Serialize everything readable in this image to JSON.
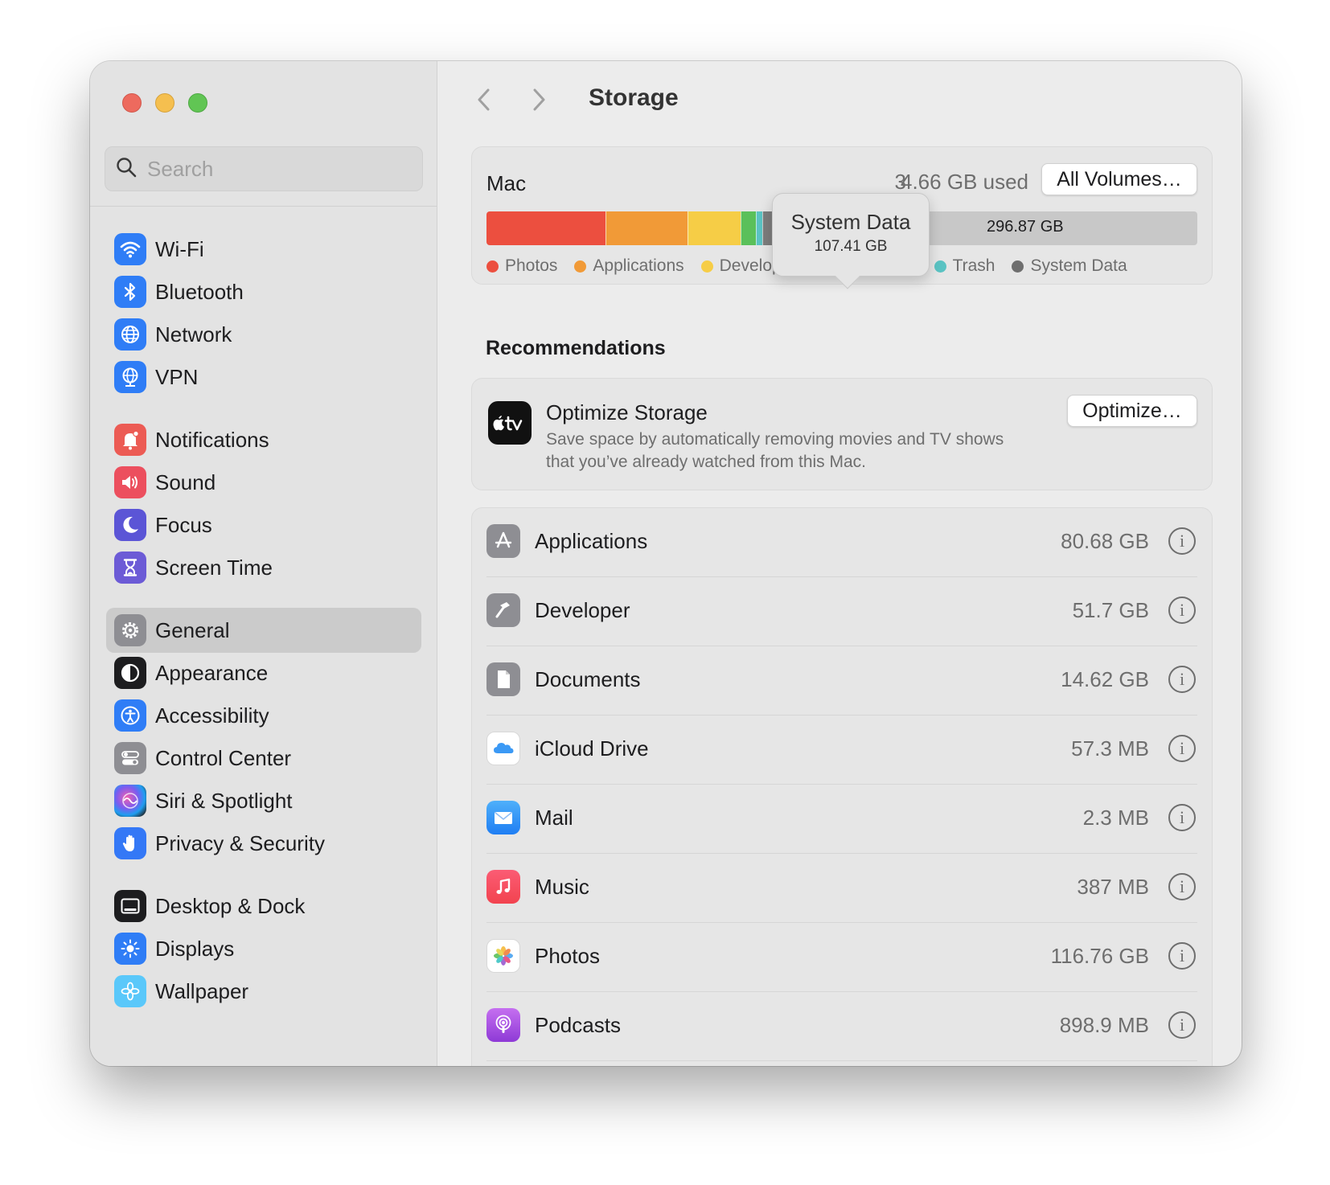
{
  "window": {
    "controls": [
      "close",
      "minimize",
      "zoom"
    ]
  },
  "sidebar": {
    "search": {
      "placeholder": "Search",
      "value": ""
    },
    "items": [
      {
        "label": "Wi-Fi",
        "icon": "wifi-icon",
        "color": "#2f7df6"
      },
      {
        "label": "Bluetooth",
        "icon": "bluetooth-icon",
        "color": "#2f7df6"
      },
      {
        "label": "Network",
        "icon": "globe-icon",
        "color": "#2f7df6"
      },
      {
        "label": "VPN",
        "icon": "vpn-globe-icon",
        "color": "#2f7df6"
      },
      {
        "label": "Notifications",
        "icon": "bell-icon",
        "color": "#ec5b54"
      },
      {
        "label": "Sound",
        "icon": "speaker-icon",
        "color": "#ec4f5e"
      },
      {
        "label": "Focus",
        "icon": "moon-icon",
        "color": "#5b55d6"
      },
      {
        "label": "Screen Time",
        "icon": "hourglass-icon",
        "color": "#6c5bd6"
      },
      {
        "label": "General",
        "icon": "gear-icon",
        "color": "#8e8e93",
        "selected": true
      },
      {
        "label": "Appearance",
        "icon": "appearance-icon",
        "color": "#1d1d1f"
      },
      {
        "label": "Accessibility",
        "icon": "accessibility-icon",
        "color": "#2f7df6"
      },
      {
        "label": "Control Center",
        "icon": "toggles-icon",
        "color": "#8e8e93"
      },
      {
        "label": "Siri & Spotlight",
        "icon": "siri-icon",
        "color": "#222222"
      },
      {
        "label": "Privacy & Security",
        "icon": "hand-icon",
        "color": "#3478f6"
      },
      {
        "label": "Desktop & Dock",
        "icon": "dock-icon",
        "color": "#1d1d1f"
      },
      {
        "label": "Displays",
        "icon": "sun-icon",
        "color": "#2f7df6"
      },
      {
        "label": "Wallpaper",
        "icon": "flower-icon",
        "color": "#5ac8fa"
      }
    ]
  },
  "main": {
    "title": "Storage",
    "storage": {
      "volume": "Mac",
      "used_text": "4.66 GB used",
      "used_prefix_visible": "3",
      "all_volumes_label": "All Volumes…",
      "free_label": "296.87 GB",
      "segments": [
        {
          "name": "Photos",
          "color": "#ec4f3f",
          "fraction": 0.167
        },
        {
          "name": "Applications",
          "color": "#f19a37",
          "fraction": 0.116
        },
        {
          "name": "Developer",
          "color": "#f6cd46",
          "fraction": 0.075
        },
        {
          "name": "Documents",
          "color": "#5ac05a",
          "fraction": 0.021
        },
        {
          "name": "Trash",
          "color": "#5ac3c3",
          "fraction": 0.009
        },
        {
          "name": "System Data",
          "color": "#7d7d7d",
          "fraction": 0.155
        },
        {
          "name": "",
          "color": "#a0a0a0",
          "fraction": 0.03
        },
        {
          "name": "Free",
          "color": "#c8c8c8",
          "fraction": 0.427
        }
      ],
      "legend": [
        {
          "label": "Photos",
          "color": "#ec4f3f"
        },
        {
          "label": "Applications",
          "color": "#f19a37"
        },
        {
          "label": "Developer",
          "color": "#f6cd46"
        },
        {
          "label": "Documents",
          "color": "#5ac05a"
        },
        {
          "label": "Trash",
          "color": "#5ac3c3"
        },
        {
          "label": "System Data",
          "color": "#6e6e6e"
        }
      ],
      "tooltip": {
        "title": "System Data",
        "value": "107.41 GB"
      }
    },
    "recommendations_title": "Recommendations",
    "recommendation": {
      "title": "Optimize Storage",
      "description": "Save space by automatically removing movies and TV shows that you’ve already watched from this Mac.",
      "button_label": "Optimize…",
      "icon": "apple-tv-icon"
    },
    "categories": [
      {
        "label": "Applications",
        "size": "80.68 GB",
        "icon": "app-store-icon",
        "color": "#8e8e93"
      },
      {
        "label": "Developer",
        "size": "51.7 GB",
        "icon": "hammer-icon",
        "color": "#8e8e93"
      },
      {
        "label": "Documents",
        "size": "14.62 GB",
        "icon": "document-icon",
        "color": "#8e8e93"
      },
      {
        "label": "iCloud Drive",
        "size": "57.3 MB",
        "icon": "icloud-icon",
        "color": "#ffffff"
      },
      {
        "label": "Mail",
        "size": "2.3 MB",
        "icon": "mail-icon",
        "color": "#2f8cf6"
      },
      {
        "label": "Music",
        "size": "387 MB",
        "icon": "music-icon",
        "color": "#f2434f"
      },
      {
        "label": "Photos",
        "size": "116.76 GB",
        "icon": "photos-icon",
        "color": "#ffffff"
      },
      {
        "label": "Podcasts",
        "size": "898.9 MB",
        "icon": "podcasts-icon",
        "color": "#a64fe0"
      }
    ]
  }
}
